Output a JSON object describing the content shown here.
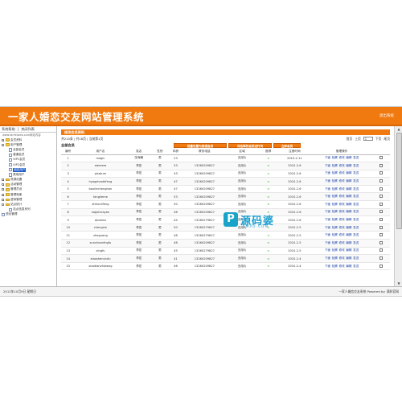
{
  "app": {
    "title": "一家人婚恋交友网站管理系统",
    "exit_label": "退出系统"
  },
  "sidebar": {
    "tabs": [
      "系统帮助",
      "关闭列表"
    ],
    "url": "www.fanfeiweb.com网站内容",
    "tree": [
      {
        "label": "会员资料",
        "type": "folder",
        "level": 0,
        "toggle": "+"
      },
      {
        "label": "用户管理",
        "type": "folder",
        "level": 0,
        "toggle": "-"
      },
      {
        "label": "全部会员",
        "type": "page",
        "level": 1
      },
      {
        "label": "普通会员",
        "type": "page",
        "level": 1
      },
      {
        "label": "VIP1会员",
        "type": "page",
        "level": 1
      },
      {
        "label": "VIP2会员",
        "type": "page",
        "level": 1
      },
      {
        "label": "锁定用户",
        "type": "page",
        "level": 1,
        "selected": true
      },
      {
        "label": "禁用用户",
        "type": "page",
        "level": 1
      },
      {
        "label": "资源设置",
        "type": "folder",
        "level": 0,
        "toggle": "+"
      },
      {
        "label": "活动管理",
        "type": "folder",
        "level": 0,
        "toggle": "+"
      },
      {
        "label": "管理员设",
        "type": "folder",
        "level": 0,
        "toggle": "+"
      },
      {
        "label": "管理相册",
        "type": "folder",
        "level": 0,
        "toggle": "+"
      },
      {
        "label": "虚拟管理",
        "type": "folder",
        "level": 0,
        "toggle": "+"
      },
      {
        "label": "站点统计",
        "type": "folder",
        "level": 0,
        "toggle": "-"
      },
      {
        "label": "站点信息系列",
        "type": "page",
        "level": 1
      },
      {
        "label": "退出管理",
        "type": "page",
        "level": 0
      }
    ]
  },
  "main": {
    "section_title": "修改会员资料",
    "pager": {
      "summary": "共210条 | 共18页 | 当前第1页",
      "first": "首页",
      "prev": "上页",
      "page": "1",
      "next": "下页",
      "last": "尾页"
    },
    "grid_title": "全部会员",
    "action_buttons": [
      "批量设置为普通会员",
      "对选择的会员进行关",
      "立即会员"
    ],
    "columns": [
      "编号",
      "用户名",
      "姓名",
      "性别",
      "年龄",
      "联系电话",
      "区域",
      "推荐",
      "注册时间",
      "管理操作",
      ""
    ],
    "ops": [
      "下面",
      "检察",
      "修改",
      "编辑",
      "发送"
    ],
    "rows": [
      {
        "id": "1",
        "user": "magic",
        "name": "张海朝",
        "sex": "男",
        "age": "23",
        "phone": "",
        "area": "无用片",
        "rec": "×",
        "date": "2010-2-11"
      },
      {
        "id": "2",
        "user": "aiemere",
        "name": "李宏",
        "sex": "男",
        "age": "53",
        "phone": "13260209827",
        "area": "无用片",
        "rec": "×",
        "date": "2010-2-6"
      },
      {
        "id": "3",
        "user": "pisaturn",
        "name": "李宏",
        "sex": "男",
        "age": "43",
        "phone": "13260209827",
        "area": "无用片",
        "rec": "×",
        "date": "2010-2-6"
      },
      {
        "id": "4",
        "user": "hyagshanbifeng",
        "name": "李宏",
        "sex": "男",
        "age": "47",
        "phone": "13260209827",
        "area": "无用片",
        "rec": "×",
        "date": "2010-2-6"
      },
      {
        "id": "5",
        "user": "bouilechenghan",
        "name": "李宏",
        "sex": "男",
        "age": "47",
        "phone": "13260209827",
        "area": "无用片",
        "rec": "×",
        "date": "2010-2-6"
      },
      {
        "id": "6",
        "user": "fanglieme",
        "name": "李宏",
        "sex": "男",
        "age": "53",
        "phone": "13260209827",
        "area": "无用片",
        "rec": "×",
        "date": "2010-2-6"
      },
      {
        "id": "7",
        "user": "zhituniifeng",
        "name": "李宏",
        "sex": "男",
        "age": "50",
        "phone": "13260209827",
        "area": "无用片",
        "rec": "×",
        "date": "2010-2-6"
      },
      {
        "id": "8",
        "user": "nagshicayan",
        "name": "李宏",
        "sex": "男",
        "age": "46",
        "phone": "13260209827",
        "area": "无用片",
        "rec": "×",
        "date": "2010-2-6"
      },
      {
        "id": "9",
        "user": "qinalian",
        "name": "李宏",
        "sex": "男",
        "age": "44",
        "phone": "13260279827",
        "area": "无用片",
        "rec": "×",
        "date": "2010-2-6"
      },
      {
        "id": "10",
        "user": "chengxin",
        "name": "李宏",
        "sex": "男",
        "age": "50",
        "phone": "13260279827",
        "area": "无用片",
        "rec": "×",
        "date": "2010-2-5"
      },
      {
        "id": "11",
        "user": "zhaguang",
        "name": "李宏",
        "sex": "男",
        "age": "48",
        "phone": "13260279827",
        "area": "无用片",
        "rec": "×",
        "date": "2010-2-5"
      },
      {
        "id": "12",
        "user": "zuncheonfngfu",
        "name": "李宏",
        "sex": "男",
        "age": "48",
        "phone": "13260209827",
        "area": "无用片",
        "rec": "×",
        "date": "2010-2-5"
      },
      {
        "id": "13",
        "user": "xingfu",
        "name": "李宏",
        "sex": "男",
        "age": "45",
        "phone": "13260279827",
        "area": "无用片",
        "rec": "×",
        "date": "2010-2-5"
      },
      {
        "id": "14",
        "user": "xiaoshenxiufu",
        "name": "李宏",
        "sex": "男",
        "age": "41",
        "phone": "13260209827",
        "area": "无用片",
        "rec": "×",
        "date": "2010-2-4"
      },
      {
        "id": "15",
        "user": "xiaotianzhiwang",
        "name": "李宏",
        "sex": "男",
        "age": "46",
        "phone": "13260209827",
        "area": "无用片",
        "rec": "×",
        "date": "2010-2-4"
      }
    ]
  },
  "status": {
    "left": "2012年10月9日 星期日",
    "right": "一家人婚恋交友系统 Powered by: 满科官网"
  },
  "watermark": {
    "mark": "P",
    "text": "源码婆",
    "sub": "YMPO.COM"
  },
  "colors": {
    "accent": "#f07a10",
    "link": "#1a3fa6",
    "watermark": "#1a9fd0"
  }
}
